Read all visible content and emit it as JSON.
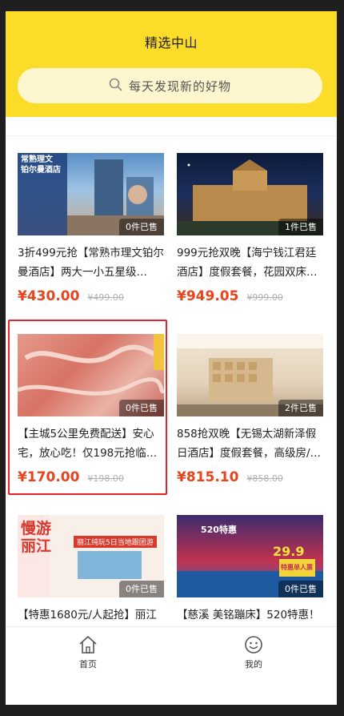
{
  "header": {
    "title": "精选中山",
    "search_placeholder": "每天发现新的好物"
  },
  "products": [
    {
      "title": "3折499元抢【常熟市理文铂尔曼酒店】两大一小五星级…",
      "price": "¥430.00",
      "original_price": "¥499.00",
      "sold": "0件已售",
      "thumb_text": [
        "常熟理文",
        "铂尔曼酒店"
      ]
    },
    {
      "title": "999元抢双晚【海宁钱江君廷酒店】度假套餐，花园双床…",
      "price": "¥949.05",
      "original_price": "¥999.00",
      "sold": "1件已售",
      "thumb_text": []
    },
    {
      "title": "【主城5公里免费配送】安心宅，放心吃！仅198元抢临…",
      "price": "¥170.00",
      "original_price": "¥198.00",
      "sold": "0件已售",
      "thumb_text": []
    },
    {
      "title": "858抢双晚【无锡太湖新泽假日酒店】度假套餐，高级房/…",
      "price": "¥815.10",
      "original_price": "¥858.00",
      "sold": "2件已售",
      "thumb_text": []
    },
    {
      "title": "【特惠1680元/人起抢】丽江",
      "price": "",
      "original_price": "",
      "sold": "0件已售",
      "thumb_text": [
        "慢游",
        "丽江",
        "丽江纯玩5日当地跟团游"
      ]
    },
    {
      "title": "【慈溪 美铭蹦床】520特惠！",
      "price": "",
      "original_price": "",
      "sold": "0件已售",
      "thumb_text": [
        "520特惠",
        "29.9",
        "特惠单人票"
      ]
    }
  ],
  "nav": {
    "home_label": "首页",
    "mine_label": "我的"
  },
  "colors": {
    "header_bg": "#fbdc29",
    "price": "#e8431d",
    "highlight_border": "#e52525"
  }
}
